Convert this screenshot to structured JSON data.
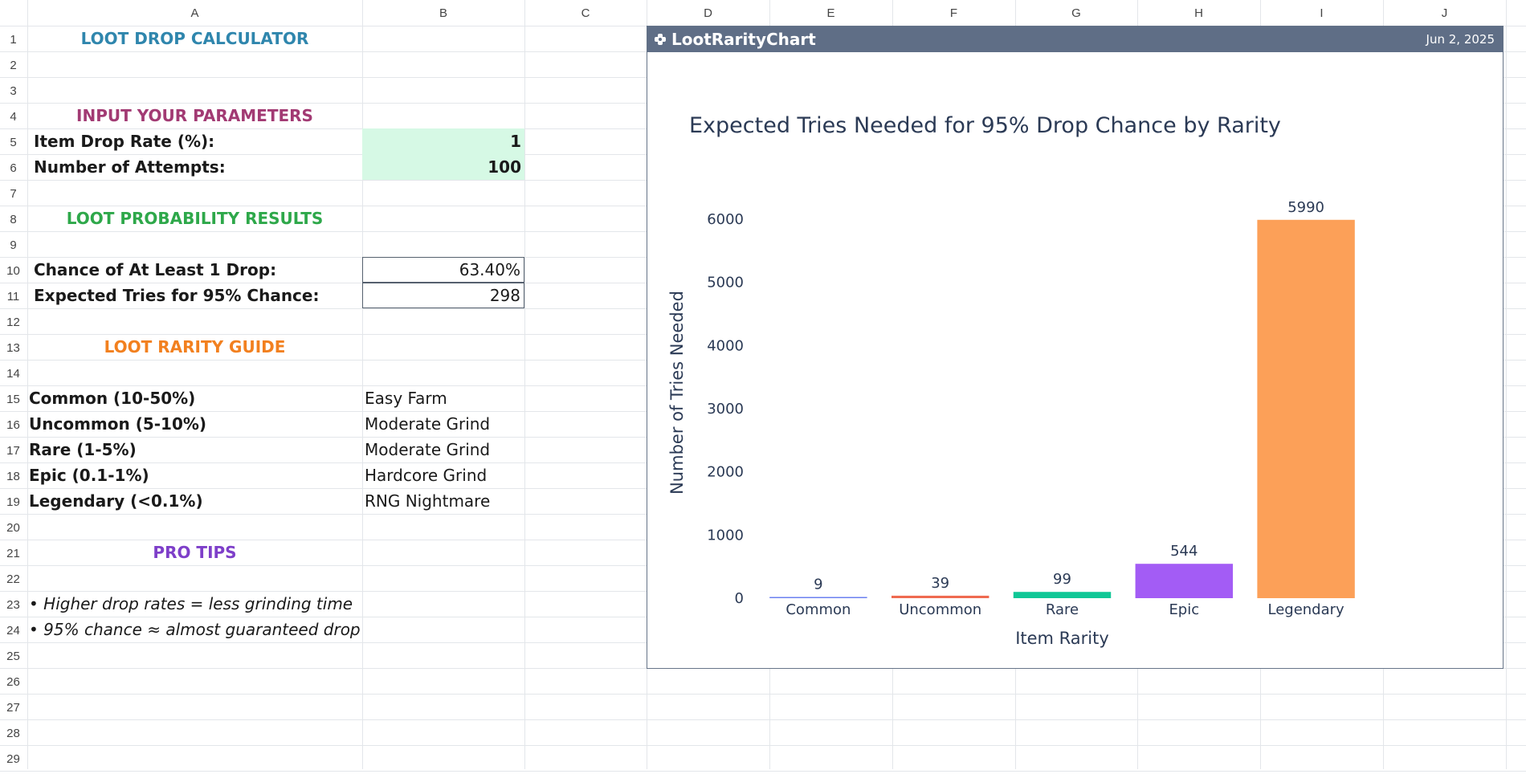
{
  "columns": [
    "A",
    "B",
    "C",
    "D",
    "E",
    "F",
    "G",
    "H",
    "I",
    "J"
  ],
  "rows": [
    "1",
    "2",
    "3",
    "4",
    "5",
    "6",
    "7",
    "8",
    "9",
    "10",
    "11",
    "12",
    "13",
    "14",
    "15",
    "16",
    "17",
    "18",
    "19",
    "20",
    "21",
    "22",
    "23",
    "24",
    "25",
    "26",
    "27",
    "28",
    "29"
  ],
  "sheet": {
    "title": "LOOT DROP CALCULATOR",
    "input_header": "INPUT YOUR PARAMETERS",
    "drop_rate_label": "Item Drop Rate (%):",
    "drop_rate_value": "1",
    "attempts_label": "Number of Attempts:",
    "attempts_value": "100",
    "results_header": "LOOT PROBABILITY RESULTS",
    "chance_label": "Chance of At Least 1 Drop:",
    "chance_value": "63.40%",
    "tries_label": "Expected Tries for 95% Chance:",
    "tries_value": "298",
    "guide_header": "LOOT RARITY GUIDE",
    "guide": [
      {
        "tier": "Common (10-50%)",
        "desc": "Easy Farm"
      },
      {
        "tier": "Uncommon (5-10%)",
        "desc": "Moderate Grind"
      },
      {
        "tier": "Rare (1-5%)",
        "desc": "Moderate Grind"
      },
      {
        "tier": "Epic (0.1-1%)",
        "desc": "Hardcore Grind"
      },
      {
        "tier": "Legendary (<0.1%)",
        "desc": "RNG Nightmare"
      }
    ],
    "tips_header": "PRO TIPS",
    "tips": [
      "• Higher drop rates = less grinding time",
      "• 95% chance ≈ almost guaranteed drop"
    ]
  },
  "colors": {
    "title": "#2f86ad",
    "input_header": "#a23a73",
    "results_header": "#2ea84a",
    "guide_header": "#f2801f",
    "tips_header": "#7e3fc9",
    "input_fill": "#d6f9e5",
    "chart_titlebar": "#5f6e86"
  },
  "chart_panel": {
    "name": "LootRarityChart",
    "date": "Jun 2, 2025"
  },
  "chart_data": {
    "type": "bar",
    "title": "Expected Tries Needed for 95% Drop Chance by Rarity",
    "xlabel": "Item Rarity",
    "ylabel": "Number of Tries Needed",
    "categories": [
      "Common",
      "Uncommon",
      "Rare",
      "Epic",
      "Legendary"
    ],
    "values": [
      9,
      39,
      99,
      544,
      5990
    ],
    "colors": [
      "#6b80f0",
      "#ef6a50",
      "#10c796",
      "#a35cf5",
      "#fca058"
    ],
    "ylim": [
      0,
      6000
    ],
    "yticks": [
      0,
      1000,
      2000,
      3000,
      4000,
      5000,
      6000
    ],
    "grid": false,
    "legend": "none"
  }
}
